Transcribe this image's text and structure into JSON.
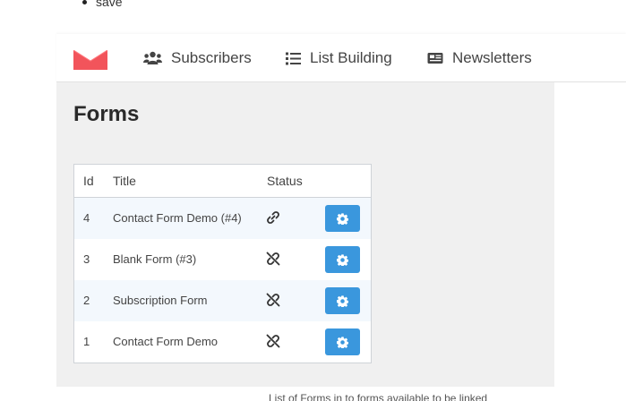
{
  "top_bullet": {
    "text": "save"
  },
  "nav": {
    "items": [
      {
        "label": "Subscribers",
        "icon": "users-icon"
      },
      {
        "label": "List Building",
        "icon": "list-icon"
      },
      {
        "label": "Newsletters",
        "icon": "newspaper-icon"
      }
    ]
  },
  "page": {
    "title": "Forms"
  },
  "table": {
    "headers": {
      "id": "Id",
      "title": "Title",
      "status": "Status"
    },
    "rows": [
      {
        "id": "4",
        "title": "Contact Form Demo (#4)",
        "status": "linked"
      },
      {
        "id": "3",
        "title": "Blank Form (#3)",
        "status": "unlinked"
      },
      {
        "id": "2",
        "title": "Subscription Form",
        "status": "unlinked"
      },
      {
        "id": "1",
        "title": "Contact Form Demo",
        "status": "unlinked"
      }
    ]
  },
  "footer": {
    "text": "List of Forms in to forms available to be linked"
  },
  "colors": {
    "accent": "#3a97dd",
    "logo": "#f2545b",
    "content_bg": "#f0f0f0"
  }
}
